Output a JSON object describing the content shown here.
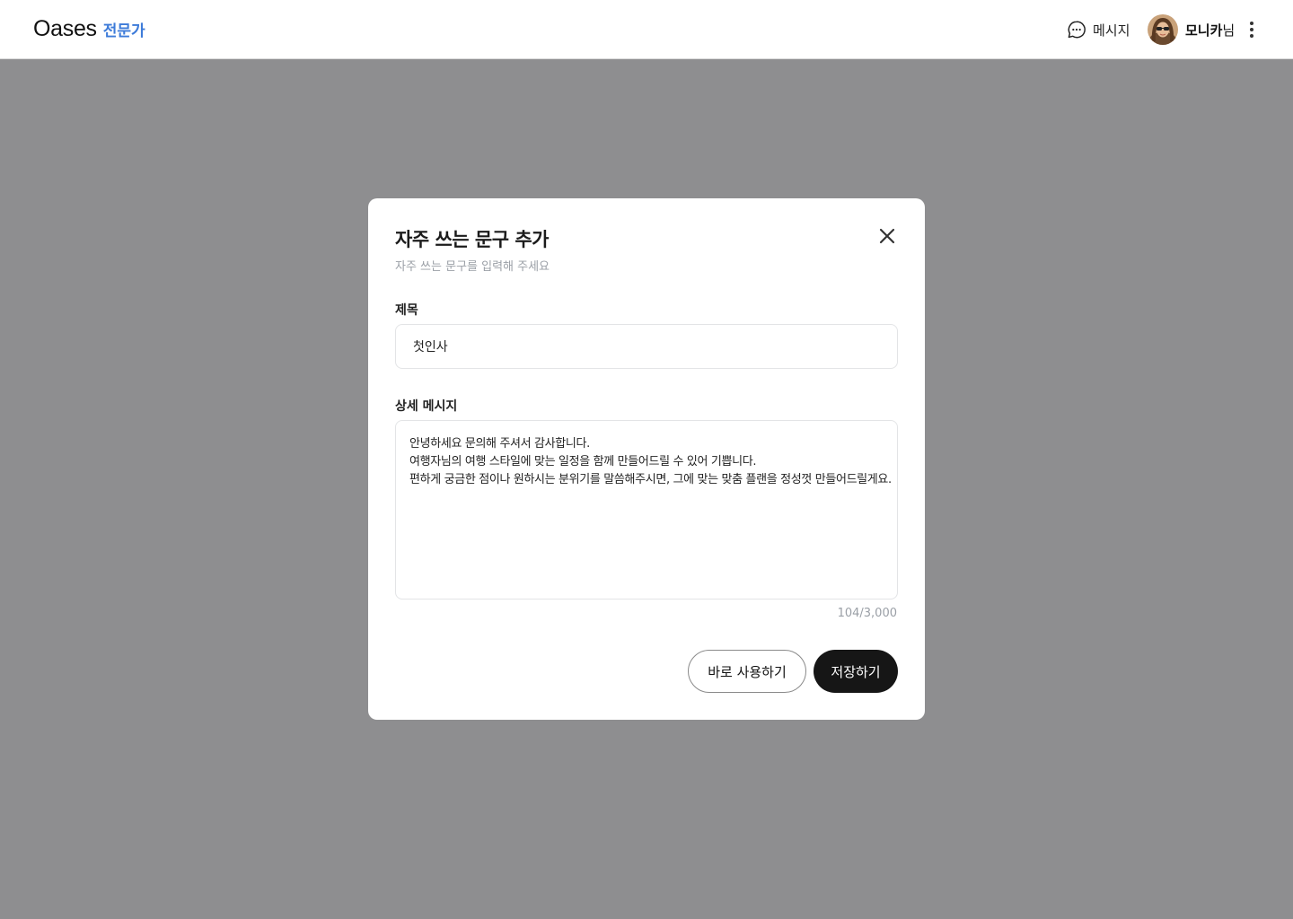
{
  "header": {
    "logo_main": "Oases",
    "logo_sub": "전문가",
    "message_label": "메시지",
    "user_name": "모니카",
    "user_suffix": "님",
    "colors": {
      "accent": "#3d7bd9"
    }
  },
  "modal": {
    "title": "자주 쓰는 문구 추가",
    "subtitle": "자주 쓰는 문구를 입력해 주세요",
    "title_field": {
      "label": "제목",
      "value": "첫인사"
    },
    "detail_field": {
      "label": "상세 메시지",
      "lines": [
        "안녕하세요 문의해 주셔서 감사합니다.",
        "여행자님의 여행 스타일에 맞는 일정을 함께 만들어드릴 수 있어 기쁩니다.",
        "편하게 궁금한 점이나 원하시는 분위기를 말씀해주시면, 그에 맞는 맞춤 플랜을 정성껏 만들어드릴게요."
      ],
      "counter": "104/3,000"
    },
    "buttons": {
      "use_now": "바로 사용하기",
      "save": "저장하기"
    }
  },
  "icons": [
    "chat-icon",
    "avatar",
    "more-vert-icon",
    "close-icon"
  ]
}
